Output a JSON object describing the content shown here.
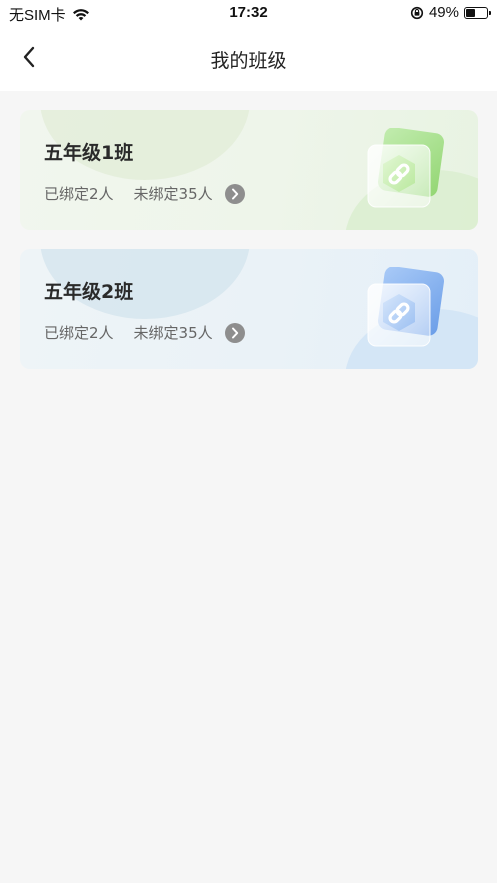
{
  "status_bar": {
    "carrier": "无SIM卡",
    "time": "17:32",
    "battery_percent": "49%",
    "battery_level": 0.49
  },
  "nav": {
    "title": "我的班级",
    "back_icon": "chevron-left-icon"
  },
  "classes": [
    {
      "name": "五年级1班",
      "bound": "已绑定2人",
      "unbound": "未绑定35人",
      "theme": "green",
      "accent": "#a8e08e",
      "icon": "link-icon"
    },
    {
      "name": "五年级2班",
      "bound": "已绑定2人",
      "unbound": "未绑定35人",
      "theme": "blue",
      "accent": "#7fb0f0",
      "icon": "link-icon"
    }
  ]
}
